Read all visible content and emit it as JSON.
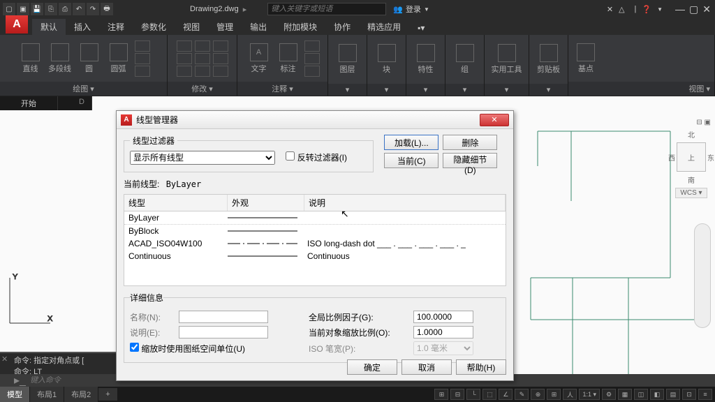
{
  "titlebar": {
    "doc_name": "Drawing2.dwg",
    "search_placeholder": "键入关键字或短语",
    "login": "登录"
  },
  "tabs": [
    "默认",
    "插入",
    "注释",
    "参数化",
    "视图",
    "管理",
    "输出",
    "附加模块",
    "协作",
    "精选应用"
  ],
  "ribbon": {
    "draw": {
      "line": "直线",
      "pline": "多段线",
      "circle": "圆",
      "arc": "圆弧",
      "title": "绘图 ▾"
    },
    "modify_title": "修改 ▾",
    "annot": {
      "text": "文字",
      "dim": "标注",
      "title": "注释 ▾"
    },
    "layer": {
      "label": "图层",
      "title": "▾"
    },
    "block": {
      "label": "块",
      "title": "▾"
    },
    "prop": {
      "label": "特性",
      "title": "▾"
    },
    "group": {
      "label": "组",
      "title": "▾"
    },
    "util": {
      "label": "实用工具",
      "title": "▾"
    },
    "clip": {
      "label": "剪贴板",
      "title": "▾"
    },
    "basepoint": {
      "label": "基点",
      "title": "视图 ▾"
    }
  },
  "start_tabs": [
    "开始",
    "D"
  ],
  "nav": {
    "north": "北",
    "west": "西",
    "top": "上",
    "east": "东",
    "south": "南",
    "wcs": "WCS ▾"
  },
  "cmd": {
    "line1": "命令: 指定对角点或 [",
    "line2": "命令: LT",
    "prompt": "键入命令"
  },
  "status": {
    "model": "模型",
    "layout1": "布局1",
    "layout2": "布局2",
    "plus": "+",
    "scale": "1:1 ▾"
  },
  "dialog": {
    "title": "线型管理器",
    "filter_legend": "线型过滤器",
    "filter_select": "显示所有线型",
    "invert": "反转过滤器(I)",
    "load": "加载(L)...",
    "delete": "删除",
    "current_btn": "当前(C)",
    "hide_detail": "隐藏细节(D)",
    "current_label": "当前线型:",
    "current_value": "ByLayer",
    "head": {
      "type": "线型",
      "appearance": "外观",
      "desc": "说明"
    },
    "rows": [
      {
        "name": "ByLayer",
        "desc": ""
      },
      {
        "name": "ByBlock",
        "desc": ""
      },
      {
        "name": "ACAD_ISO04W100",
        "desc": "ISO long-dash dot ___ . ___ . ___ . ___ . _"
      },
      {
        "name": "Continuous",
        "desc": "Continuous"
      }
    ],
    "detail": {
      "legend": "详细信息",
      "name": "名称(N):",
      "desc": "说明(E):",
      "paperspace": "缩放时使用图纸空间单位(U)",
      "global": "全局比例因子(G):",
      "global_val": "100.0000",
      "obj": "当前对象缩放比例(O):",
      "obj_val": "1.0000",
      "pen": "ISO 笔宽(P):",
      "pen_val": "1.0 毫米"
    },
    "ok": "确定",
    "cancel": "取消",
    "help": "帮助(H)"
  }
}
